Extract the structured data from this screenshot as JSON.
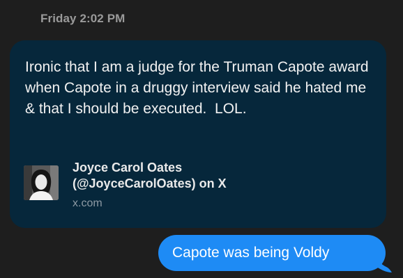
{
  "conversation": {
    "timestamp": "Friday 2:02 PM",
    "received_message": {
      "text": "Ironic that I am a judge for the Truman Capote award when Capote in a druggy interview said he hated me & that I should be executed.  LOL.",
      "link_preview": {
        "title_line1": "Joyce Carol Oates",
        "title_line2": "(@JoyceCarolOates) on X",
        "domain": "x.com",
        "avatar_icon": "profile-photo-icon"
      }
    },
    "sent_message": {
      "text": "Capote was being Voldy"
    }
  },
  "colors": {
    "background": "#1e1e1e",
    "received_bubble": "#06273b",
    "sent_bubble": "#1e8bf5",
    "timestamp": "#9a9a9a"
  }
}
